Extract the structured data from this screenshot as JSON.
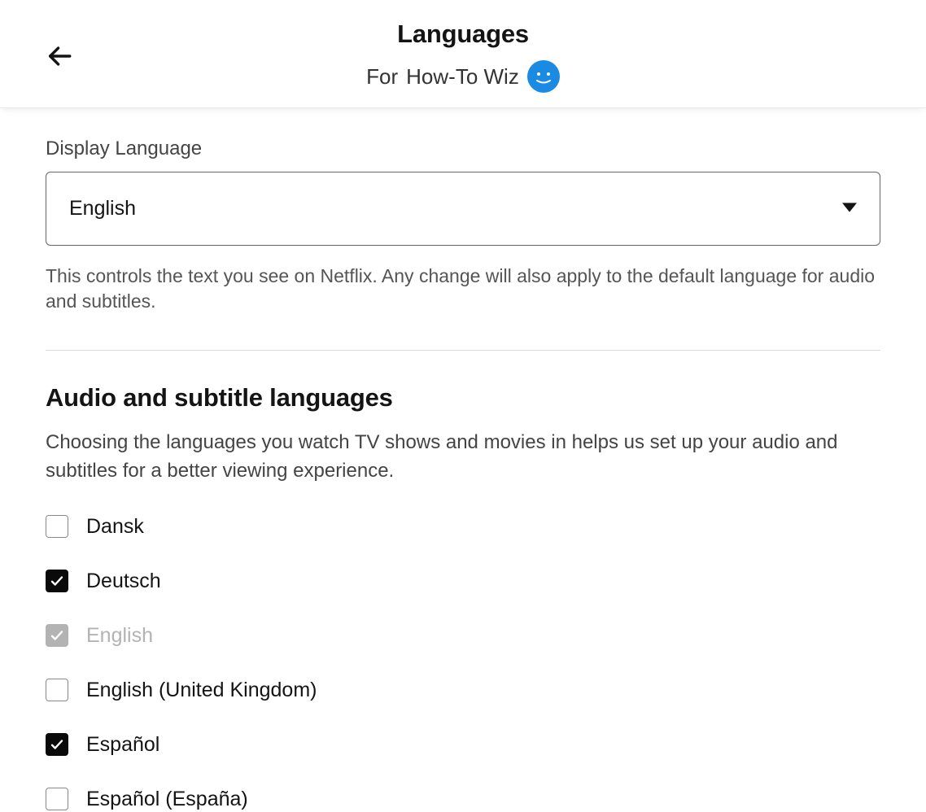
{
  "header": {
    "title": "Languages",
    "subtitle_prefix": "For",
    "profile_name": "How-To Wiz"
  },
  "display_language": {
    "label": "Display Language",
    "selected": "English",
    "helper": "This controls the text you see on Netflix. Any change will also apply to the default language for audio and subtitles."
  },
  "audio_subtitle": {
    "title": "Audio and subtitle languages",
    "description": "Choosing the languages you watch TV shows and movies in helps us set up your audio and subtitles for a better viewing experience.",
    "items": [
      {
        "label": "Dansk",
        "checked": false,
        "disabled": false
      },
      {
        "label": "Deutsch",
        "checked": true,
        "disabled": false
      },
      {
        "label": "English",
        "checked": true,
        "disabled": true
      },
      {
        "label": "English (United Kingdom)",
        "checked": false,
        "disabled": false
      },
      {
        "label": "Español",
        "checked": true,
        "disabled": false
      },
      {
        "label": "Español (España)",
        "checked": false,
        "disabled": false
      }
    ]
  }
}
